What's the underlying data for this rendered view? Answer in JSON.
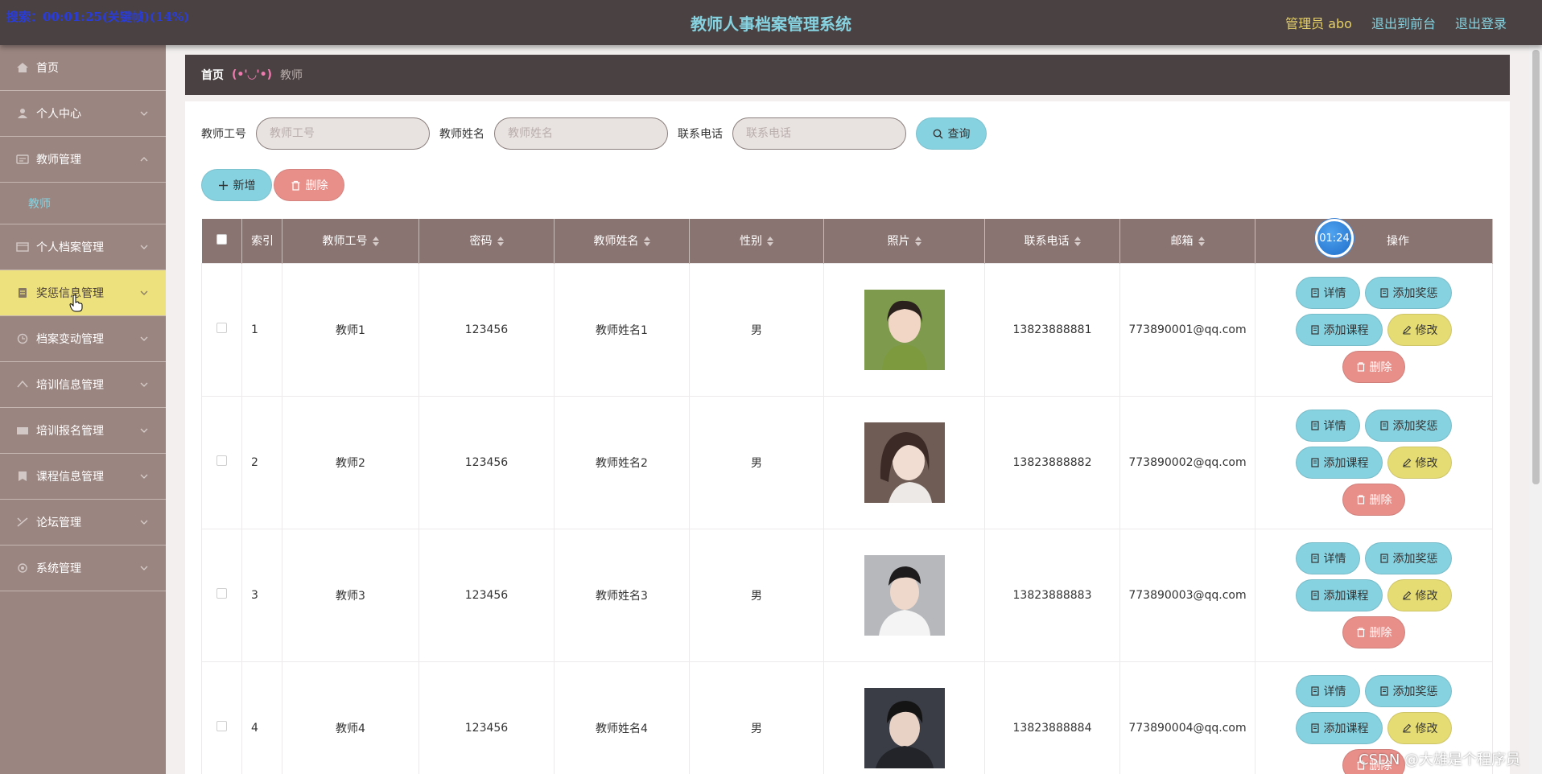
{
  "header": {
    "recording_overlay": "搜索：00:01:25(关键帧)(14%)",
    "app_title": "教师人事档案管理系统",
    "admin_label": "管理员 abo",
    "to_front": "退出到前台",
    "logout": "退出登录"
  },
  "sidebar": {
    "items": [
      {
        "label": "首页",
        "icon": "home-icon"
      },
      {
        "label": "个人中心",
        "icon": "user-icon"
      },
      {
        "label": "教师管理",
        "icon": "teacher-icon"
      },
      {
        "label": "个人档案管理",
        "icon": "archive-icon"
      },
      {
        "label": "奖惩信息管理",
        "icon": "award-icon"
      },
      {
        "label": "档案变动管理",
        "icon": "change-icon"
      },
      {
        "label": "培训信息管理",
        "icon": "training-icon"
      },
      {
        "label": "培训报名管理",
        "icon": "signup-icon"
      },
      {
        "label": "课程信息管理",
        "icon": "course-icon"
      },
      {
        "label": "论坛管理",
        "icon": "forum-icon"
      },
      {
        "label": "系统管理",
        "icon": "system-icon"
      }
    ],
    "submenu_teacher": "教师",
    "active_item": "奖惩信息管理"
  },
  "breadcrumb": {
    "home": "首页",
    "separator": "(•'◡'•)",
    "current": "教师"
  },
  "search": {
    "teacher_id_label": "教师工号",
    "teacher_id_placeholder": "教师工号",
    "teacher_name_label": "教师姓名",
    "teacher_name_placeholder": "教师姓名",
    "phone_label": "联系电话",
    "phone_placeholder": "联系电话",
    "query_button": "查询"
  },
  "actions": {
    "add_button": "新增",
    "delete_button": "删除"
  },
  "table": {
    "columns": [
      "索引",
      "教师工号",
      "密码",
      "教师姓名",
      "性别",
      "照片",
      "联系电话",
      "邮箱",
      "操作"
    ],
    "rows": [
      {
        "index": "1",
        "teacher_id": "教师1",
        "password": "123456",
        "name": "教师姓名1",
        "gender": "男",
        "phone": "13823888881",
        "email": "773890001@qq.com"
      },
      {
        "index": "2",
        "teacher_id": "教师2",
        "password": "123456",
        "name": "教师姓名2",
        "gender": "男",
        "phone": "13823888882",
        "email": "773890002@qq.com"
      },
      {
        "index": "3",
        "teacher_id": "教师3",
        "password": "123456",
        "name": "教师姓名3",
        "gender": "男",
        "phone": "13823888883",
        "email": "773890003@qq.com"
      },
      {
        "index": "4",
        "teacher_id": "教师4",
        "password": "123456",
        "name": "教师姓名4",
        "gender": "男",
        "phone": "13823888884",
        "email": "773890004@qq.com"
      }
    ],
    "row_ops": {
      "detail": "详情",
      "add_award": "添加奖惩",
      "add_course": "添加课程",
      "edit": "修改",
      "delete": "删除"
    }
  },
  "timer_badge": "01:24",
  "watermark": "CSDN @大雄是个程序员",
  "colors": {
    "header_bg": "#4a4242",
    "sidebar_bg": "#9b8580",
    "active_bg": "#ede17e",
    "accent_cyan": "#86d2e0",
    "accent_yellow": "#e6dc74",
    "accent_red": "#e88f8a",
    "table_header_bg": "#8a7471"
  }
}
